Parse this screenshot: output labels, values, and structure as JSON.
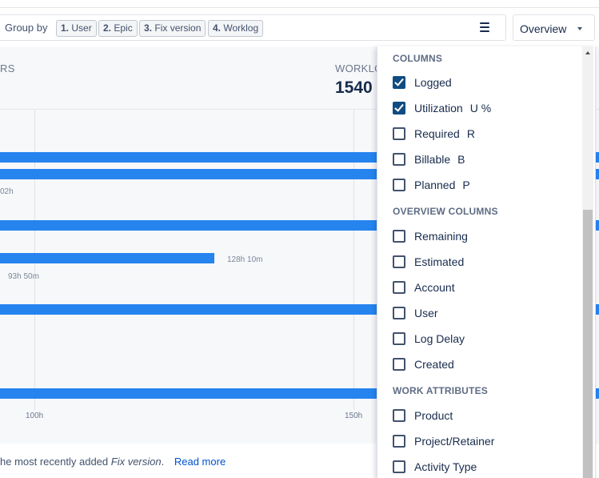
{
  "toolbar": {
    "group_by_label": "Group by",
    "chips": [
      {
        "num": "1.",
        "label": "User"
      },
      {
        "num": "2.",
        "label": "Epic"
      },
      {
        "num": "3.",
        "label": "Fix version"
      },
      {
        "num": "4.",
        "label": "Worklog"
      }
    ],
    "menu_icon": "hamburger-menu-icon",
    "view_select": "Overview"
  },
  "summary": {
    "left_label": "RS",
    "worklog_label": "WORKLO",
    "worklog_value": "1540"
  },
  "chart": {
    "bar_color": "#2684ef",
    "bar_labels": [
      "02h",
      "128h 10m",
      "93h 50m"
    ],
    "ticks": [
      "100h",
      "150h"
    ]
  },
  "footer": {
    "text_before": "he most recently added ",
    "text_italic": "Fix version",
    "text_after": ".",
    "link": "Read more"
  },
  "dropdown": {
    "sections": [
      {
        "title": "COLUMNS",
        "options": [
          {
            "label": "Logged",
            "abbr": "",
            "checked": true
          },
          {
            "label": "Utilization",
            "abbr": "U %",
            "checked": true
          },
          {
            "label": "Required",
            "abbr": "R",
            "checked": false
          },
          {
            "label": "Billable",
            "abbr": "B",
            "checked": false
          },
          {
            "label": "Planned",
            "abbr": "P",
            "checked": false
          }
        ]
      },
      {
        "title": "OVERVIEW COLUMNS",
        "options": [
          {
            "label": "Remaining",
            "abbr": "",
            "checked": false
          },
          {
            "label": "Estimated",
            "abbr": "",
            "checked": false
          },
          {
            "label": "Account",
            "abbr": "",
            "checked": false
          },
          {
            "label": "User",
            "abbr": "",
            "checked": false
          },
          {
            "label": "Log Delay",
            "abbr": "",
            "checked": false
          },
          {
            "label": "Created",
            "abbr": "",
            "checked": false
          }
        ]
      },
      {
        "title": "WORK ATTRIBUTES",
        "options": [
          {
            "label": "Product",
            "abbr": "",
            "checked": false
          },
          {
            "label": "Project/Retainer",
            "abbr": "",
            "checked": false
          },
          {
            "label": "Activity Type",
            "abbr": "",
            "checked": false
          }
        ]
      }
    ]
  }
}
